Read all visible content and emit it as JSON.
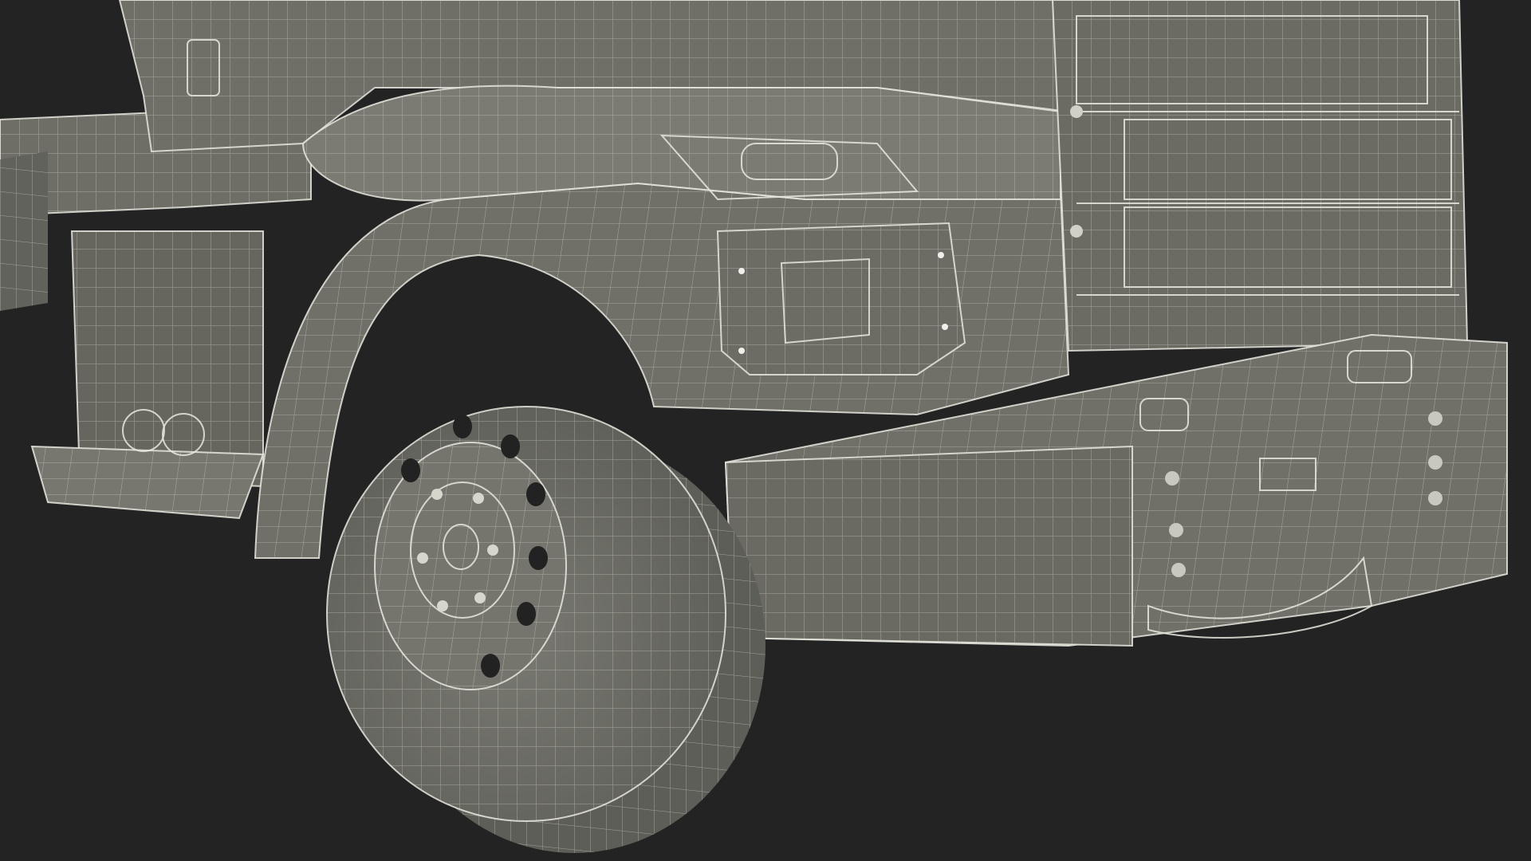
{
  "scene": {
    "subject": "",
    "colors": {
      "background": "#232323",
      "mesh_fill": "#72726b",
      "mesh_fill_dark": "#5a5a54",
      "mesh_fill_light": "#85857d",
      "wire": "#d9d9cf",
      "accent_white": "#f0f0ea"
    }
  }
}
